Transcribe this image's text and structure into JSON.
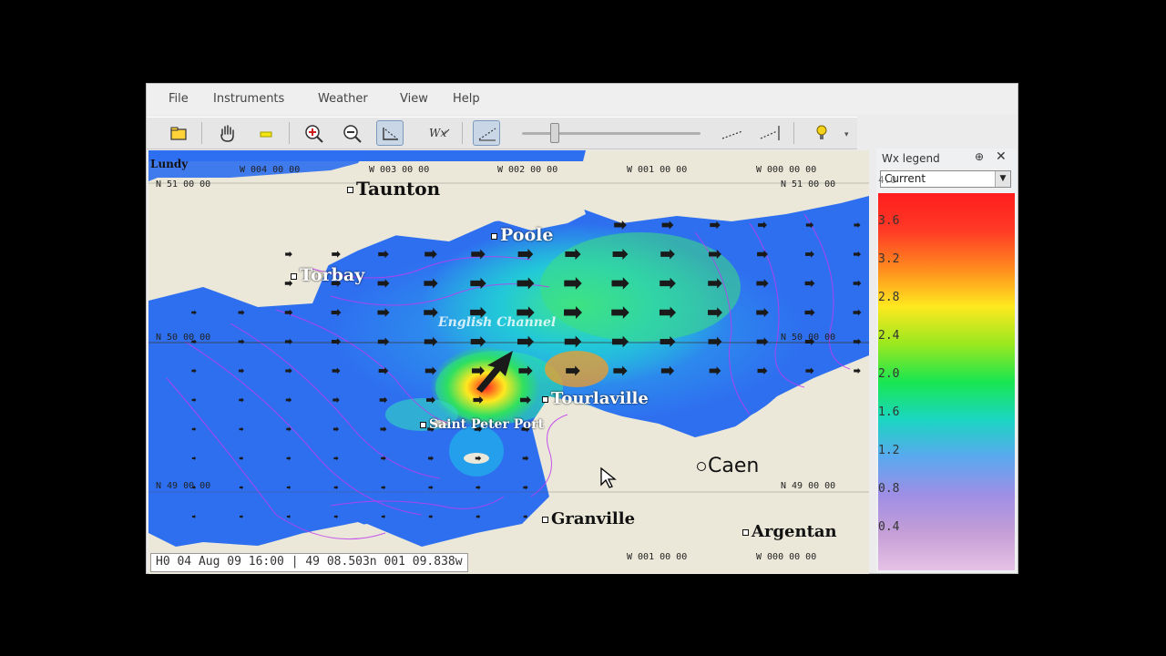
{
  "menu": [
    "File",
    "Instruments",
    "Weather",
    "View",
    "Help"
  ],
  "toolbar": {
    "open_icon": "folder-open-icon",
    "pan_icon": "hand-pan-icon",
    "highlight_icon": "yellow-highlighter-icon",
    "zoom_in_icon": "zoom-in-icon",
    "zoom_out_icon": "zoom-out-icon",
    "route_icon": "route-tool-icon",
    "wx_icon": "wx-overlay-icon",
    "grid_icon": "grid-icon",
    "step_back_icon": "step-back-icon",
    "step_forward_icon": "step-forward-icon",
    "help_icon": "help-bulb-icon",
    "time_slider_fraction": 0.18
  },
  "map": {
    "top_longitudes": [
      "W 004 00 00",
      "W 003 00 00",
      "W 002 00 00",
      "W 001 00 00",
      "W 000 00 00"
    ],
    "bottom_longitudes": [
      "W 001 00 00",
      "W 000 00 00"
    ],
    "latitudes": {
      "n51_left": "N 51 00 00",
      "n51_right": "N 51 00 00",
      "n50_left": "N 50 00 00",
      "n50_right": "N 50 00 00",
      "n49_left": "N 49 00 00",
      "n49_right": "N 49 00 00"
    },
    "places": {
      "lundy": "Lundy",
      "taunton": "Taunton",
      "poole": "Poole",
      "torbay": "Torbay",
      "english_channel": "English Channel",
      "tourlaville": "Tourlaville",
      "saint_peter_port": "Saint Peter Port",
      "caen": "Caen",
      "granville": "Granville",
      "argentan": "Argentan"
    },
    "colors": {
      "land": "#ebe8d9",
      "sea": "#2e74ec",
      "contour": "#c03cf0",
      "arrow": "#1a1a1a"
    }
  },
  "status": "H0 04 Aug 09 16:00 | 49 08.503n  001 09.838w",
  "legend": {
    "title": "Wx legend",
    "pin": "⊕",
    "close": "✕",
    "selected": "Current",
    "labels": [
      "4.0",
      "3.6",
      "3.2",
      "2.8",
      "2.4",
      "2.0",
      "1.6",
      "1.2",
      "0.8",
      "0.4"
    ],
    "colors": [
      "#ff1d1d",
      "#ff3a26",
      "#ff8a1e",
      "#ffe81f",
      "#9ae81f",
      "#19e650",
      "#1ad6c2",
      "#5aa8ee",
      "#9f8ee6",
      "#c49ed6",
      "#e6c2e6"
    ]
  }
}
